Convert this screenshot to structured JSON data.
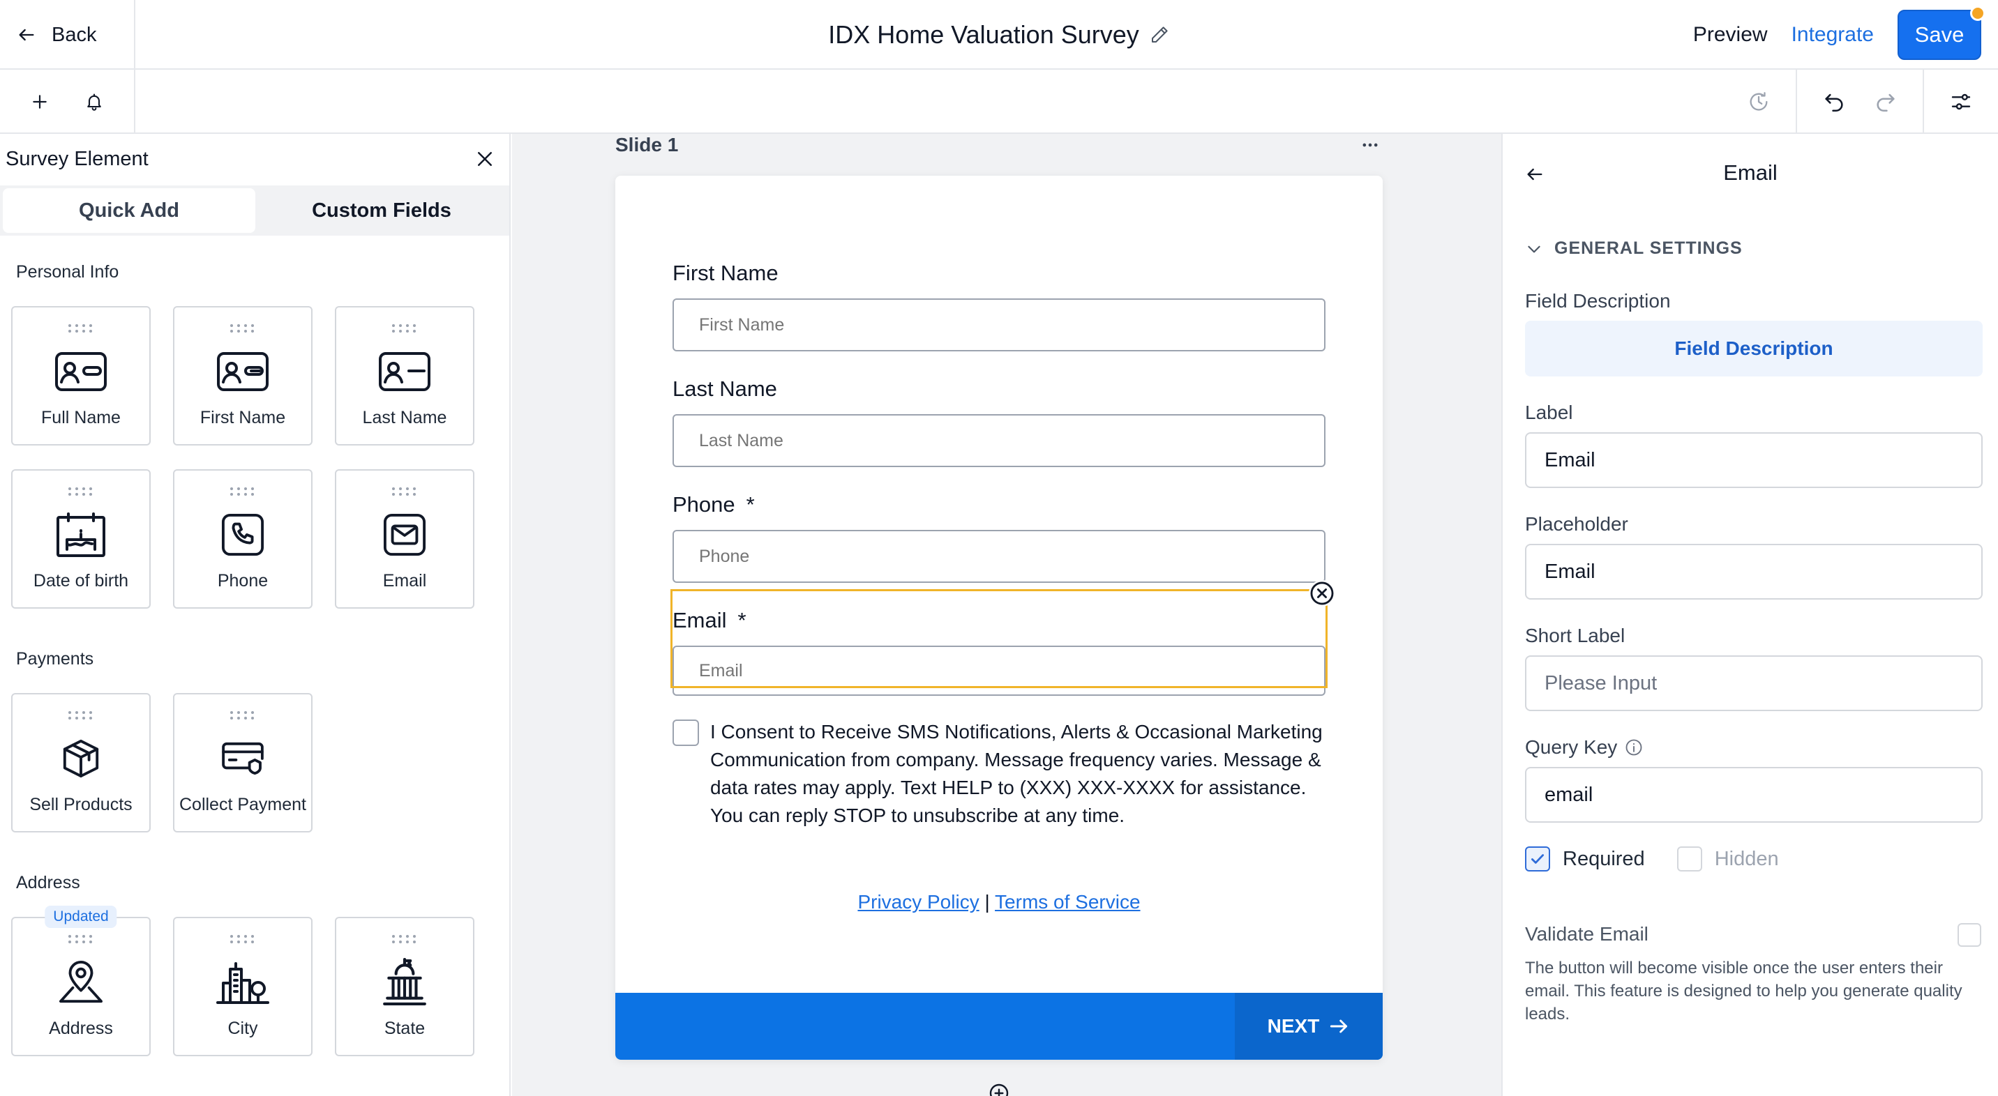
{
  "header": {
    "back_label": "Back",
    "title": "IDX Home Valuation Survey",
    "preview_label": "Preview",
    "integrate_label": "Integrate",
    "save_label": "Save"
  },
  "left_panel": {
    "title": "Survey Element",
    "tabs": [
      {
        "label": "Quick Add"
      },
      {
        "label": "Custom Fields"
      }
    ],
    "sections": [
      {
        "title": "Personal Info",
        "items": [
          {
            "label": "Full Name",
            "icon": "id-card-icon"
          },
          {
            "label": "First Name",
            "icon": "id-card-icon"
          },
          {
            "label": "Last Name",
            "icon": "id-card-icon"
          },
          {
            "label": "Date of birth",
            "icon": "cake-calendar-icon"
          },
          {
            "label": "Phone",
            "icon": "phone-icon"
          },
          {
            "label": "Email",
            "icon": "mail-icon"
          }
        ]
      },
      {
        "title": "Payments",
        "items": [
          {
            "label": "Sell Products",
            "icon": "box-icon"
          },
          {
            "label": "Collect Payment",
            "icon": "card-icon"
          }
        ]
      },
      {
        "title": "Address",
        "items": [
          {
            "label": "Address",
            "icon": "map-pin-icon",
            "badge": "Updated"
          },
          {
            "label": "City",
            "icon": "city-icon"
          },
          {
            "label": "State",
            "icon": "capitol-icon"
          }
        ]
      }
    ]
  },
  "canvas": {
    "slide_label": "Slide 1",
    "fields": [
      {
        "label": "First Name",
        "placeholder": "First Name",
        "required": ""
      },
      {
        "label": "Last Name",
        "placeholder": "Last Name",
        "required": ""
      },
      {
        "label": "Phone",
        "placeholder": "Phone",
        "required": "*"
      },
      {
        "label": "Email",
        "placeholder": "Email",
        "required": "*"
      }
    ],
    "consent_text": "I Consent to Receive SMS Notifications, Alerts & Occasional Marketing Communication from company. Message frequency varies. Message & data rates may apply. Text HELP to (XXX) XXX-XXXX for assistance. You can reply STOP to unsubscribe at any time.",
    "privacy_label": "Privacy Policy",
    "separator": "|",
    "terms_label": "Terms of Service",
    "next_label": "NEXT"
  },
  "right_panel": {
    "title": "Email",
    "section_title": "GENERAL SETTINGS",
    "field_description_label": "Field Description",
    "field_description_button": "Field Description",
    "label_label": "Label",
    "label_value": "Email",
    "placeholder_label": "Placeholder",
    "placeholder_value": "Email",
    "short_label_label": "Short Label",
    "short_label_placeholder": "Please Input",
    "query_key_label": "Query Key",
    "query_key_value": "email",
    "required_label": "Required",
    "hidden_label": "Hidden",
    "validate_email_label": "Validate Email",
    "validate_email_desc": "The button will become visible once the user enters their email. This feature is designed to help you generate quality leads."
  },
  "colors": {
    "accent": "#1570ef",
    "link": "#1d6fe0",
    "selection": "#f0b429",
    "next_bar": "#0c73e4"
  }
}
